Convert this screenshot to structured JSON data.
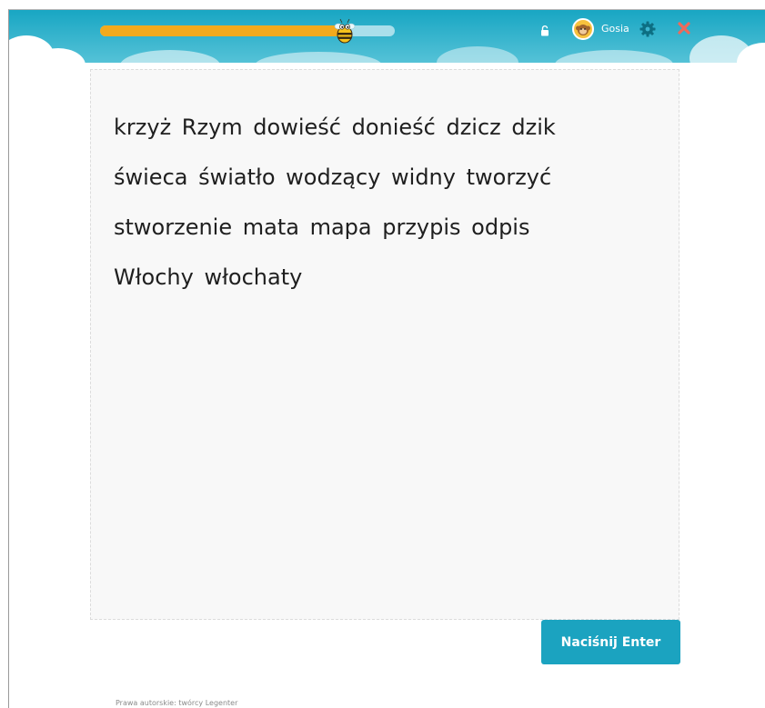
{
  "header": {
    "progress_fraction": 0.83,
    "user": {
      "name": "Gosia"
    },
    "icons": [
      "bee-icon",
      "lock-icon",
      "avatar",
      "gear-icon",
      "close-icon"
    ],
    "colors": {
      "header": "#18a6c3",
      "progress": "#f3aa1d",
      "progress_track": "#a9dfeb",
      "close": "#ef6a5a"
    }
  },
  "exercise": {
    "lines": [
      "krzyż Rzym dowieść donieść dzicz dzik",
      "świeca światło wodzący widny tworzyć",
      "stworzenie mata mapa przypis odpis",
      "Włochy włochaty"
    ]
  },
  "actions": {
    "enter_label": "Naciśnij Enter",
    "color": "#1ba3c0"
  },
  "footer": {
    "text": "Prawa autorskie: twórcy Legenter"
  }
}
